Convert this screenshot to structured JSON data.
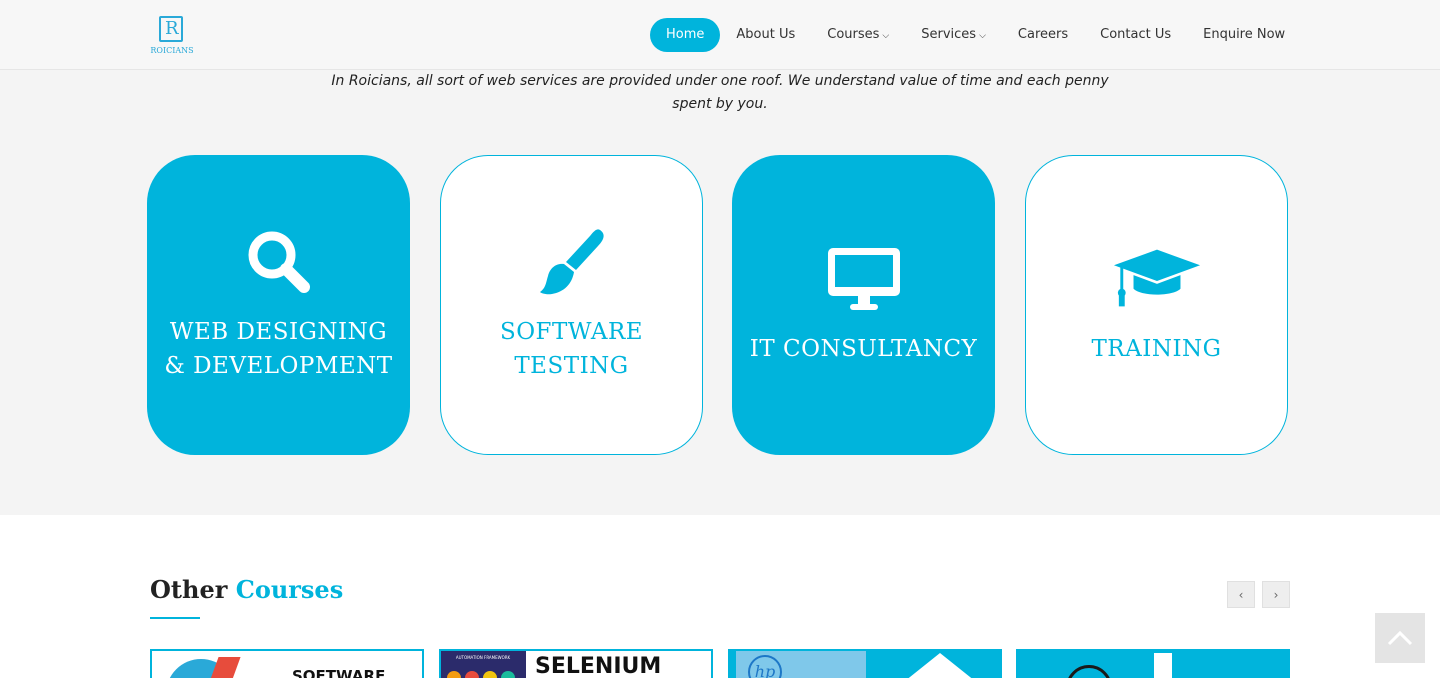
{
  "brand": {
    "logo_letter": "R",
    "logo_text": "ROICIANS"
  },
  "nav": {
    "items": [
      {
        "label": "Home",
        "active": true,
        "dropdown": false
      },
      {
        "label": "About Us",
        "active": false,
        "dropdown": false
      },
      {
        "label": "Courses",
        "active": false,
        "dropdown": true
      },
      {
        "label": "Services",
        "active": false,
        "dropdown": true
      },
      {
        "label": "Careers",
        "active": false,
        "dropdown": false
      },
      {
        "label": "Contact Us",
        "active": false,
        "dropdown": false
      },
      {
        "label": "Enquire Now",
        "active": false,
        "dropdown": false
      }
    ]
  },
  "services": {
    "intro": "In Roicians, all sort of web services are provided under one roof. We understand value of time and each penny spent by you.",
    "cards": [
      {
        "title": "WEB DESIGNING & DEVELOPMENT",
        "icon": "search-icon",
        "style": "filled"
      },
      {
        "title": "SOFTWARE TESTING",
        "icon": "paint-brush-icon",
        "style": "outline"
      },
      {
        "title": "IT CONSULTANCY",
        "icon": "desktop-icon",
        "style": "filled"
      },
      {
        "title": "TRAINING",
        "icon": "graduation-cap-icon",
        "style": "outline"
      }
    ]
  },
  "courses": {
    "title_prefix": "Other",
    "title_accent": "Courses",
    "prev_icon": "chevron-left-icon",
    "next_icon": "chevron-right-icon",
    "thumbnails": [
      {
        "text": "SOFTWARE"
      },
      {
        "text": "SELENIUM",
        "subtext": "AUTOMATION FRAMEWORK"
      },
      {
        "text": "hp"
      },
      {
        "text": ""
      }
    ]
  },
  "colors": {
    "accent": "#00b4dc",
    "section_bg": "#f4f4f4",
    "nav_bg": "#f7f7f7"
  }
}
